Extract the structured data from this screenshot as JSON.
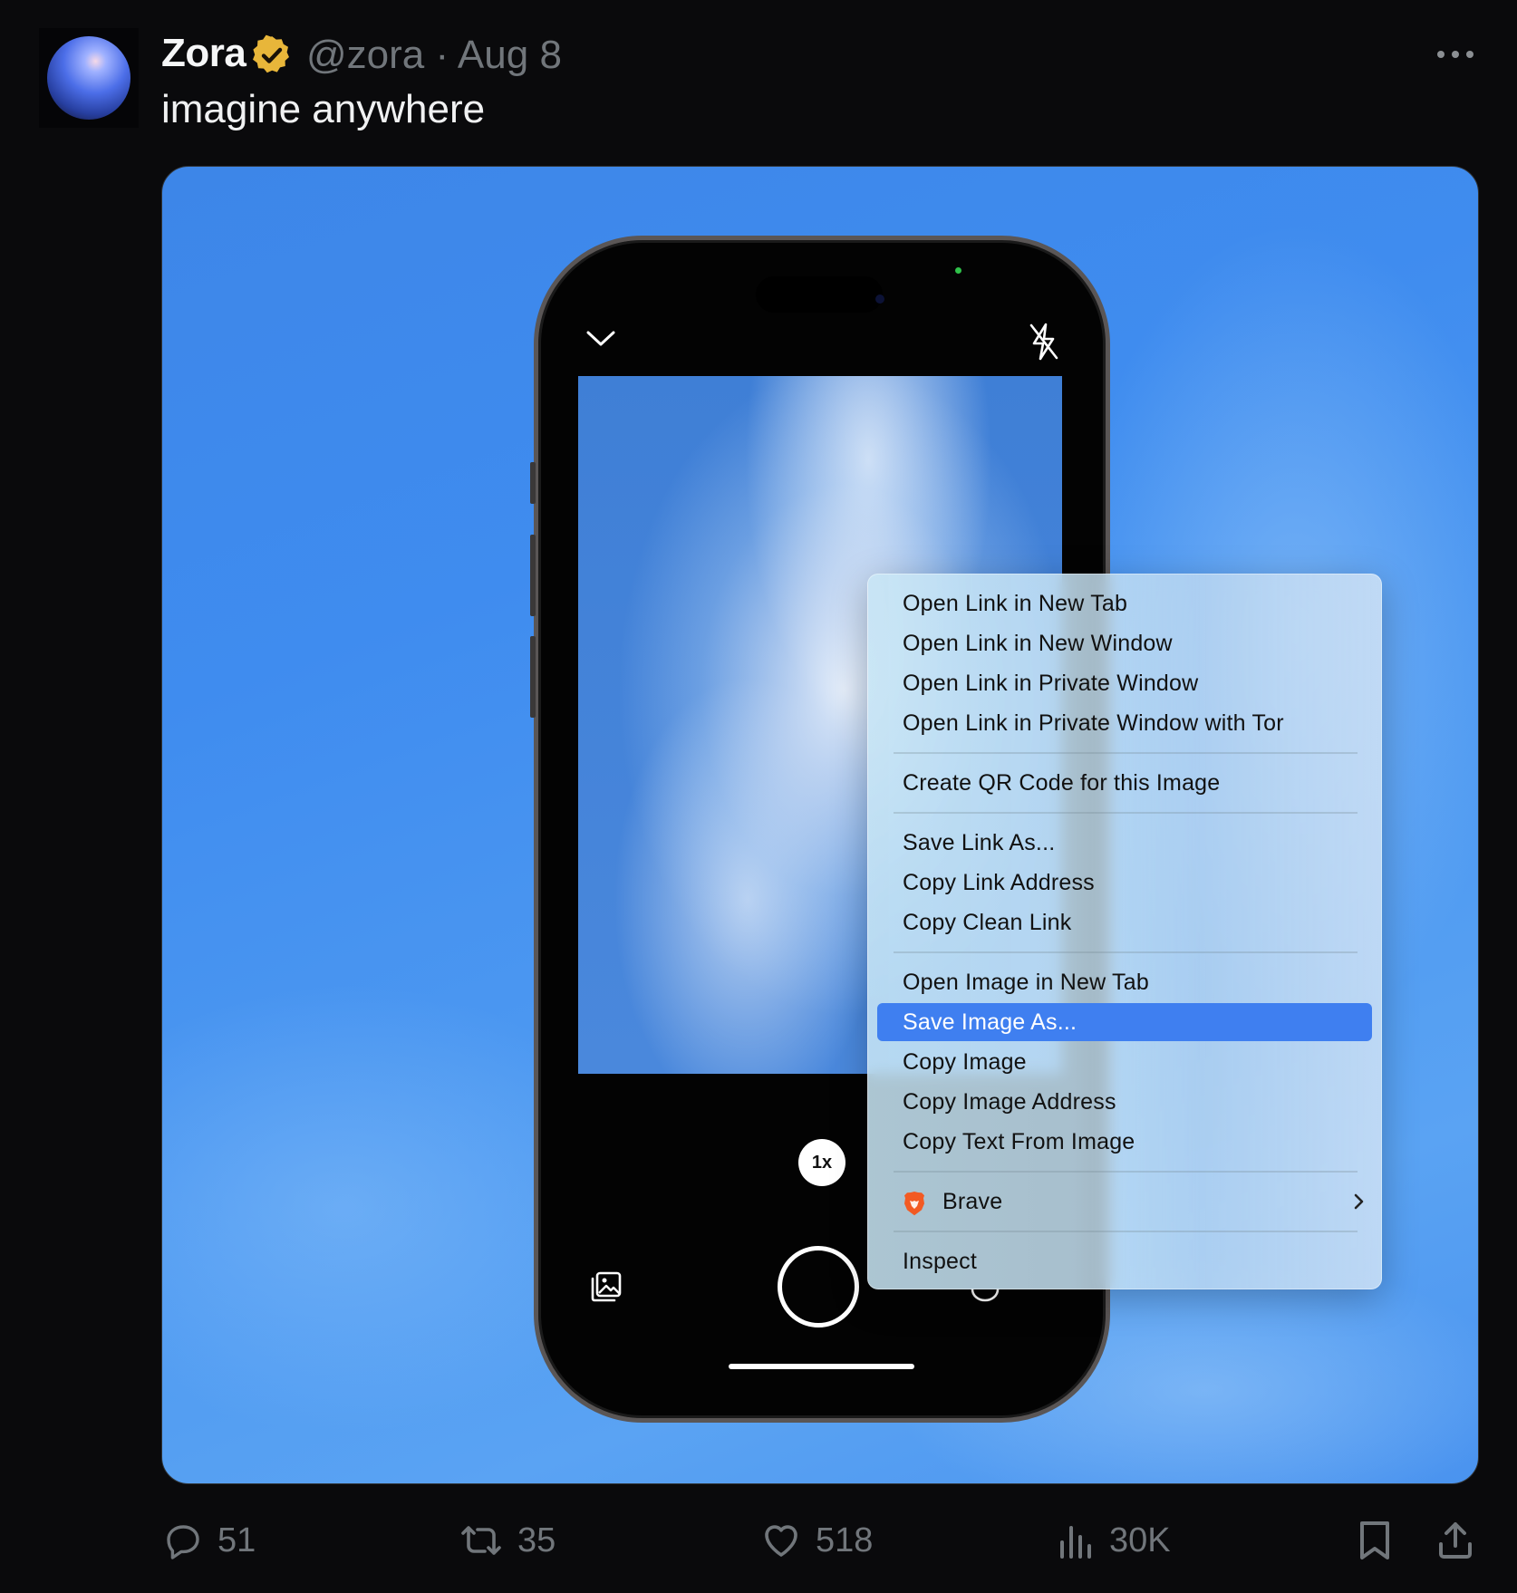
{
  "post": {
    "author_name": "Zora",
    "handle_date": "@zora · Aug 8",
    "text": "imagine anywhere"
  },
  "media": {
    "zoom_label": "1x"
  },
  "context_menu": {
    "groups": [
      [
        "Open Link in New Tab",
        "Open Link in New Window",
        "Open Link in Private Window",
        "Open Link in Private Window with Tor"
      ],
      [
        "Create QR Code for this Image"
      ],
      [
        "Save Link As...",
        "Copy Link Address",
        "Copy Clean Link"
      ],
      [
        "Open Image in New Tab",
        "Save Image As...",
        "Copy Image",
        "Copy Image Address",
        "Copy Text From Image"
      ]
    ],
    "highlighted": "Save Image As...",
    "brave_label": "Brave",
    "inspect_label": "Inspect"
  },
  "actions": {
    "replies": "51",
    "reposts": "35",
    "likes": "518",
    "views": "30K"
  },
  "colors": {
    "verified_badge": "#e8b63a",
    "menu_highlight": "#3f7ff0",
    "muted_text": "#71767b"
  }
}
